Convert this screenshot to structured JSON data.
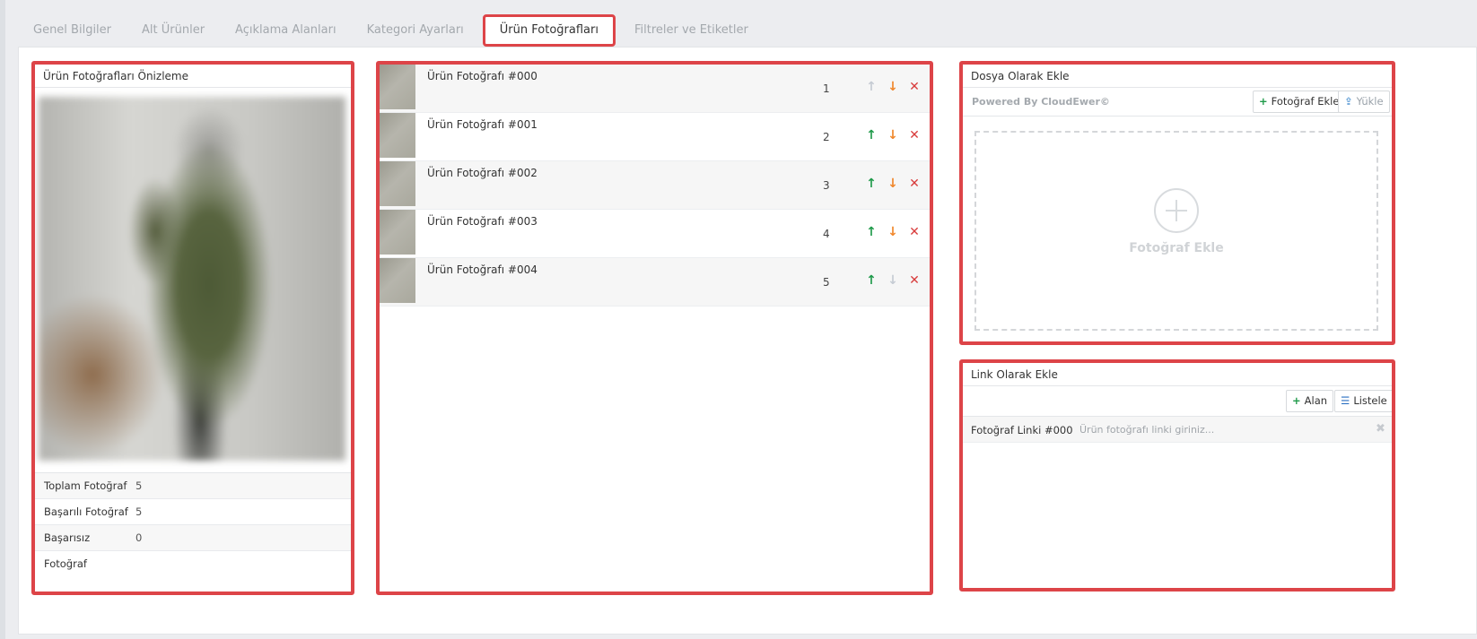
{
  "tabs": [
    {
      "label": "Genel Bilgiler"
    },
    {
      "label": "Alt Ürünler"
    },
    {
      "label": "Açıklama Alanları"
    },
    {
      "label": "Kategori Ayarları"
    },
    {
      "label": "Ürün Fotoğrafları"
    },
    {
      "label": "Filtreler ve Etiketler"
    }
  ],
  "active_tab": "Ürün Fotoğrafları",
  "preview": {
    "title": "Ürün Fotoğrafları Önizleme",
    "stats": [
      {
        "label": "Toplam Fotoğraf",
        "value": "5"
      },
      {
        "label": "Başarılı Fotoğraf",
        "value": "5"
      },
      {
        "label": "Başarısız Fotoğraf",
        "value": "0"
      }
    ]
  },
  "photos": [
    {
      "name": "Ürün Fotoğrafı #000",
      "order": "1",
      "up_enabled": false,
      "down_enabled": true
    },
    {
      "name": "Ürün Fotoğrafı #001",
      "order": "2",
      "up_enabled": true,
      "down_enabled": true
    },
    {
      "name": "Ürün Fotoğrafı #002",
      "order": "3",
      "up_enabled": true,
      "down_enabled": true
    },
    {
      "name": "Ürün Fotoğrafı #003",
      "order": "4",
      "up_enabled": true,
      "down_enabled": true
    },
    {
      "name": "Ürün Fotoğrafı #004",
      "order": "5",
      "up_enabled": true,
      "down_enabled": false
    }
  ],
  "file_panel": {
    "title": "Dosya Olarak Ekle",
    "powered_by": "Powered By CloudEwer©",
    "add_button": "Fotoğraf Ekle",
    "upload_button": "Yükle",
    "dropzone_label": "Fotoğraf Ekle"
  },
  "link_panel": {
    "title": "Link Olarak Ekle",
    "field_button": "Alan",
    "list_button": "Listele",
    "rows": [
      {
        "label": "Fotoğraf Linki #000",
        "value": "",
        "placeholder": "Ürün fotoğrafı linki giriniz..."
      }
    ]
  },
  "colors": {
    "highlight": "#dd4448",
    "up_arrow": "#1f9a4a",
    "down_arrow": "#f0862a",
    "delete": "#d83c3c",
    "disabled": "#c5cbd3"
  },
  "icons": {
    "up": "arrow-up-icon",
    "down": "arrow-down-icon",
    "delete": "close-icon",
    "add": "plus-icon",
    "upload": "upload-icon",
    "list": "list-icon"
  }
}
